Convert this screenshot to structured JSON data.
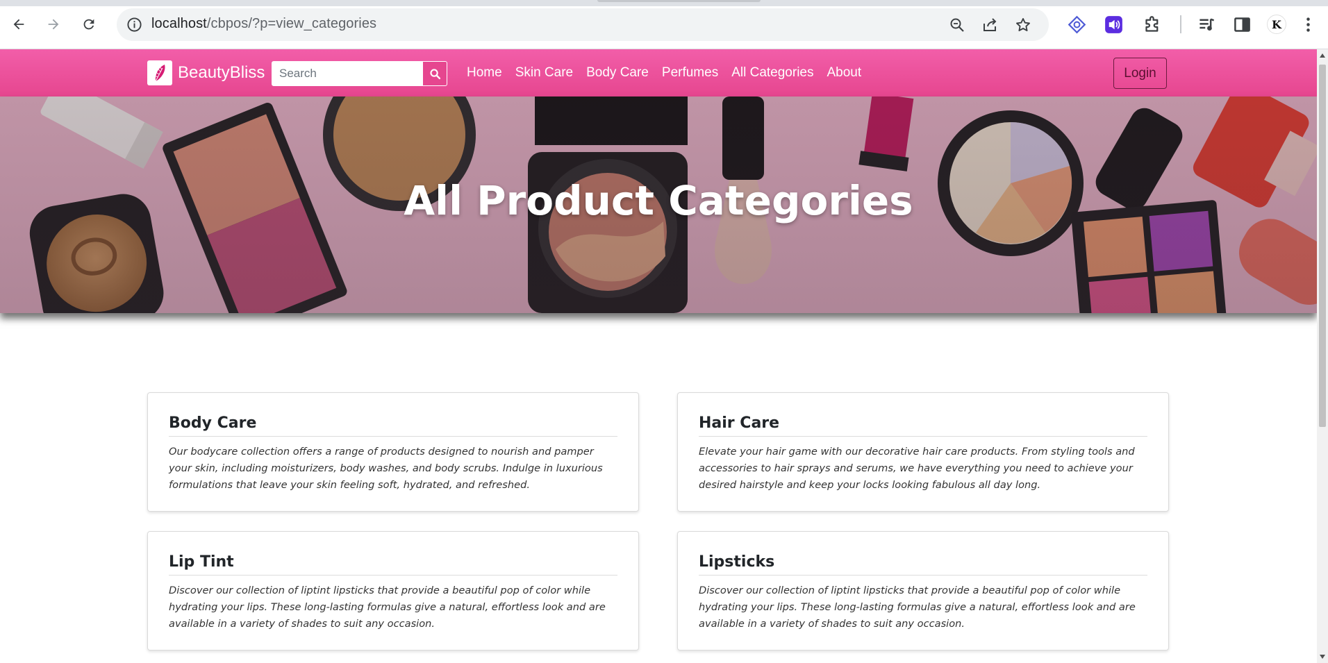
{
  "browser": {
    "url_host": "localhost",
    "url_path": "/cbpos/?p=view_categories",
    "icons": [
      "back-arrow-icon",
      "forward-arrow-icon",
      "reload-icon",
      "info-icon",
      "zoom-icon",
      "share-icon",
      "star-icon",
      "extension-icon",
      "media-icon",
      "sidebar-icon",
      "profile-avatar",
      "kebab-menu-icon"
    ],
    "profile_initial": "K"
  },
  "navbar": {
    "brand": "BeautyBliss",
    "search_placeholder": "Search",
    "links": [
      "Home",
      "Skin Care",
      "Body Care",
      "Perfumes",
      "All Categories",
      "About"
    ],
    "login_label": "Login",
    "colors": {
      "bar": "#e6468f",
      "login_border": "#6b1a3e"
    }
  },
  "hero": {
    "title": "All Product Categories"
  },
  "categories": [
    {
      "title": "Body Care",
      "description": "Our bodycare collection offers a range of products designed to nourish and pamper your skin, including moisturizers, body washes, and body scrubs. Indulge in luxurious formulations that leave your skin feeling soft, hydrated, and refreshed."
    },
    {
      "title": "Hair Care",
      "description": "Elevate your hair game with our decorative hair care products. From styling tools and accessories to hair sprays and serums, we have everything you need to achieve your desired hairstyle and keep your locks looking fabulous all day long."
    },
    {
      "title": "Lip Tint",
      "description": "Discover our collection of liptint lipsticks that provide a beautiful pop of color while hydrating your lips. These long-lasting formulas give a natural, effortless look and are available in a variety of shades to suit any occasion."
    },
    {
      "title": "Lipsticks",
      "description": "Discover our collection of liptint lipsticks that provide a beautiful pop of color while hydrating your lips. These long-lasting formulas give a natural, effortless look and are available in a variety of shades to suit any occasion."
    }
  ]
}
